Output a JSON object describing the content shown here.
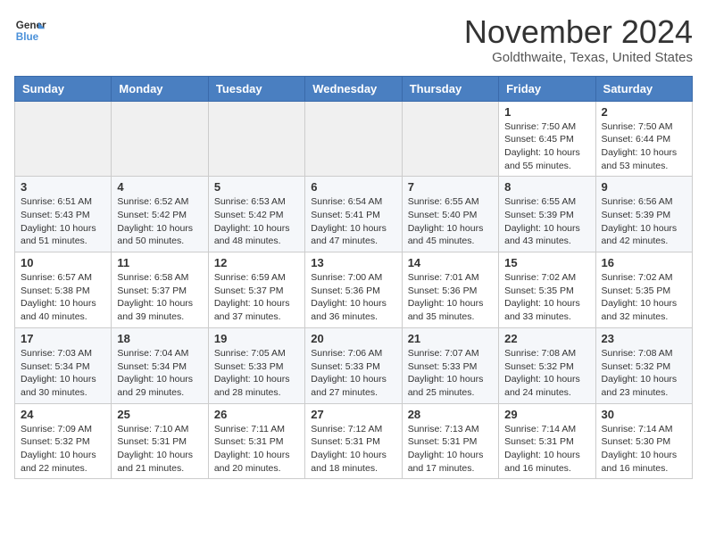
{
  "header": {
    "logo_line1": "General",
    "logo_line2": "Blue",
    "month": "November 2024",
    "location": "Goldthwaite, Texas, United States"
  },
  "weekdays": [
    "Sunday",
    "Monday",
    "Tuesday",
    "Wednesday",
    "Thursday",
    "Friday",
    "Saturday"
  ],
  "weeks": [
    [
      {
        "day": "",
        "info": ""
      },
      {
        "day": "",
        "info": ""
      },
      {
        "day": "",
        "info": ""
      },
      {
        "day": "",
        "info": ""
      },
      {
        "day": "",
        "info": ""
      },
      {
        "day": "1",
        "info": "Sunrise: 7:50 AM\nSunset: 6:45 PM\nDaylight: 10 hours and 55 minutes."
      },
      {
        "day": "2",
        "info": "Sunrise: 7:50 AM\nSunset: 6:44 PM\nDaylight: 10 hours and 53 minutes."
      }
    ],
    [
      {
        "day": "3",
        "info": "Sunrise: 6:51 AM\nSunset: 5:43 PM\nDaylight: 10 hours and 51 minutes."
      },
      {
        "day": "4",
        "info": "Sunrise: 6:52 AM\nSunset: 5:42 PM\nDaylight: 10 hours and 50 minutes."
      },
      {
        "day": "5",
        "info": "Sunrise: 6:53 AM\nSunset: 5:42 PM\nDaylight: 10 hours and 48 minutes."
      },
      {
        "day": "6",
        "info": "Sunrise: 6:54 AM\nSunset: 5:41 PM\nDaylight: 10 hours and 47 minutes."
      },
      {
        "day": "7",
        "info": "Sunrise: 6:55 AM\nSunset: 5:40 PM\nDaylight: 10 hours and 45 minutes."
      },
      {
        "day": "8",
        "info": "Sunrise: 6:55 AM\nSunset: 5:39 PM\nDaylight: 10 hours and 43 minutes."
      },
      {
        "day": "9",
        "info": "Sunrise: 6:56 AM\nSunset: 5:39 PM\nDaylight: 10 hours and 42 minutes."
      }
    ],
    [
      {
        "day": "10",
        "info": "Sunrise: 6:57 AM\nSunset: 5:38 PM\nDaylight: 10 hours and 40 minutes."
      },
      {
        "day": "11",
        "info": "Sunrise: 6:58 AM\nSunset: 5:37 PM\nDaylight: 10 hours and 39 minutes."
      },
      {
        "day": "12",
        "info": "Sunrise: 6:59 AM\nSunset: 5:37 PM\nDaylight: 10 hours and 37 minutes."
      },
      {
        "day": "13",
        "info": "Sunrise: 7:00 AM\nSunset: 5:36 PM\nDaylight: 10 hours and 36 minutes."
      },
      {
        "day": "14",
        "info": "Sunrise: 7:01 AM\nSunset: 5:36 PM\nDaylight: 10 hours and 35 minutes."
      },
      {
        "day": "15",
        "info": "Sunrise: 7:02 AM\nSunset: 5:35 PM\nDaylight: 10 hours and 33 minutes."
      },
      {
        "day": "16",
        "info": "Sunrise: 7:02 AM\nSunset: 5:35 PM\nDaylight: 10 hours and 32 minutes."
      }
    ],
    [
      {
        "day": "17",
        "info": "Sunrise: 7:03 AM\nSunset: 5:34 PM\nDaylight: 10 hours and 30 minutes."
      },
      {
        "day": "18",
        "info": "Sunrise: 7:04 AM\nSunset: 5:34 PM\nDaylight: 10 hours and 29 minutes."
      },
      {
        "day": "19",
        "info": "Sunrise: 7:05 AM\nSunset: 5:33 PM\nDaylight: 10 hours and 28 minutes."
      },
      {
        "day": "20",
        "info": "Sunrise: 7:06 AM\nSunset: 5:33 PM\nDaylight: 10 hours and 27 minutes."
      },
      {
        "day": "21",
        "info": "Sunrise: 7:07 AM\nSunset: 5:33 PM\nDaylight: 10 hours and 25 minutes."
      },
      {
        "day": "22",
        "info": "Sunrise: 7:08 AM\nSunset: 5:32 PM\nDaylight: 10 hours and 24 minutes."
      },
      {
        "day": "23",
        "info": "Sunrise: 7:08 AM\nSunset: 5:32 PM\nDaylight: 10 hours and 23 minutes."
      }
    ],
    [
      {
        "day": "24",
        "info": "Sunrise: 7:09 AM\nSunset: 5:32 PM\nDaylight: 10 hours and 22 minutes."
      },
      {
        "day": "25",
        "info": "Sunrise: 7:10 AM\nSunset: 5:31 PM\nDaylight: 10 hours and 21 minutes."
      },
      {
        "day": "26",
        "info": "Sunrise: 7:11 AM\nSunset: 5:31 PM\nDaylight: 10 hours and 20 minutes."
      },
      {
        "day": "27",
        "info": "Sunrise: 7:12 AM\nSunset: 5:31 PM\nDaylight: 10 hours and 18 minutes."
      },
      {
        "day": "28",
        "info": "Sunrise: 7:13 AM\nSunset: 5:31 PM\nDaylight: 10 hours and 17 minutes."
      },
      {
        "day": "29",
        "info": "Sunrise: 7:14 AM\nSunset: 5:31 PM\nDaylight: 10 hours and 16 minutes."
      },
      {
        "day": "30",
        "info": "Sunrise: 7:14 AM\nSunset: 5:30 PM\nDaylight: 10 hours and 16 minutes."
      }
    ]
  ]
}
